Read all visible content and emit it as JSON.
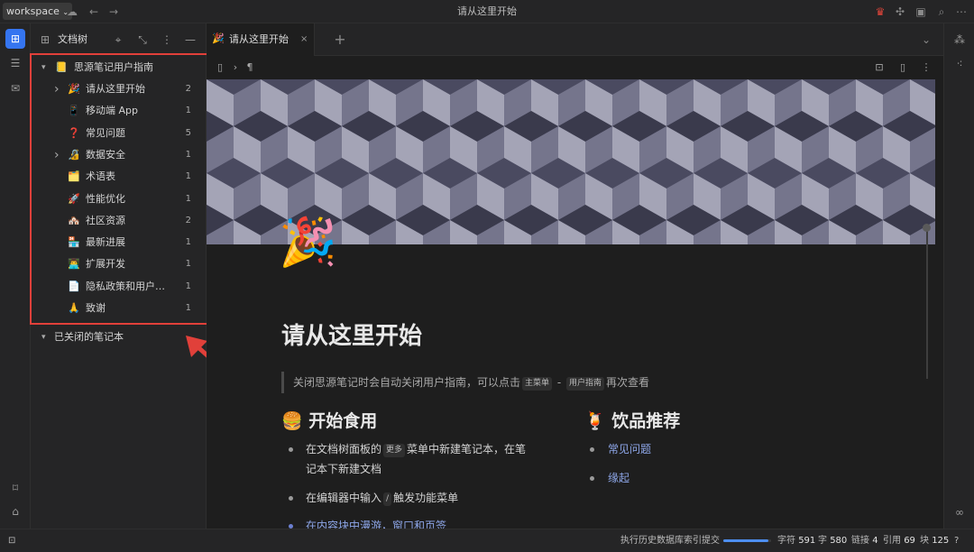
{
  "topbar": {
    "workspace_label": "workspace",
    "window_title": "请从这里开始"
  },
  "sidebar": {
    "title": "文档树",
    "notebook": {
      "emoji": "📒",
      "label": "思源笔记用户指南"
    },
    "items": [
      {
        "emoji": "🎉",
        "label": "请从这里开始",
        "count": "2",
        "expandable": true
      },
      {
        "emoji": "📱",
        "label": "移动端 App",
        "count": "1",
        "expandable": false
      },
      {
        "emoji": "❓",
        "label": "常见问题",
        "count": "5",
        "expandable": false
      },
      {
        "emoji": "🔏",
        "label": "数据安全",
        "count": "1",
        "expandable": true
      },
      {
        "emoji": "🗂️",
        "label": "术语表",
        "count": "1",
        "expandable": false
      },
      {
        "emoji": "🚀",
        "label": "性能优化",
        "count": "1",
        "expandable": false
      },
      {
        "emoji": "🏘️",
        "label": "社区资源",
        "count": "2",
        "expandable": false
      },
      {
        "emoji": "🏪",
        "label": "最新进展",
        "count": "1",
        "expandable": false
      },
      {
        "emoji": "👨‍💻",
        "label": "扩展开发",
        "count": "1",
        "expandable": false
      },
      {
        "emoji": "📄",
        "label": "隐私政策和用户…",
        "count": "1",
        "expandable": false
      },
      {
        "emoji": "🙏",
        "label": "致谢",
        "count": "1",
        "expandable": false
      }
    ],
    "closed_notebooks_label": "已关闭的笔记本"
  },
  "tab": {
    "emoji": "🎉",
    "label": "请从这里开始",
    "close": "×"
  },
  "editor": {
    "doc_emoji": "🎉",
    "title": "请从这里开始",
    "quote_before": "关闭思源笔记时会自动关闭用户指南，可以点击",
    "quote_kbd1": "主菜单",
    "quote_sep": " - ",
    "quote_kbd2": "用户指南",
    "quote_after": "再次查看",
    "section1": {
      "emoji": "🍔",
      "heading": "开始食用",
      "item1_before": "在文档树面板的",
      "item1_kbd": "更多",
      "item1_after_line1": "菜单中新建笔记本，在笔",
      "item1_line2": "记本下新建文档",
      "item2_before": "在编辑器中输入",
      "item2_kbd": "/",
      "item2_after": "触发功能菜单",
      "item3_partial": "在内容块中漫游，窗口和页签"
    },
    "section2": {
      "emoji": "🍹",
      "heading": "饮品推荐",
      "links": [
        "常见问题",
        "缘起"
      ]
    }
  },
  "statusbar": {
    "task_label": "执行历史数据库索引提交",
    "progress_fraction": 0.95,
    "chars_label": "字符",
    "chars_value": "591",
    "words_label": "字",
    "words_value": "580",
    "links_label": "链接",
    "links_value": "4",
    "refs_label": "引用",
    "refs_value": "69",
    "blocks_label": "块",
    "blocks_value": "125"
  }
}
